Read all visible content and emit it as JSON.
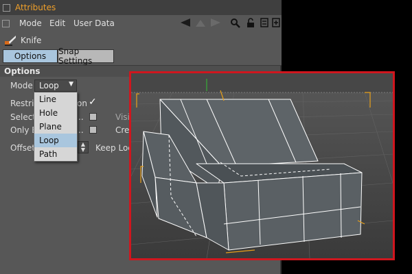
{
  "app": {
    "title": "Attributes",
    "accent_color": "#f0a02a",
    "highlight_color": "#d0161e"
  },
  "menubar": {
    "items": [
      "Mode",
      "Edit",
      "User Data"
    ],
    "icons": [
      "arrow-left-icon",
      "arrow-up-icon",
      "arrow-right-icon",
      "search-icon",
      "lock-icon",
      "settings-icon",
      "new-panel-icon"
    ]
  },
  "tool": {
    "name": "Knife",
    "icon": "knife-icon"
  },
  "tabs": {
    "options": "Options",
    "snap_settings": "Snap Settings"
  },
  "section": {
    "title": "Options"
  },
  "fields": {
    "mode_label": "Mode",
    "mode_value": "Loop",
    "restrict_label": "Restric",
    "restrict_label_tail": "on",
    "select_label": "Select",
    "select_tail": "..",
    "only_label": "Only E",
    "only_tail": "..",
    "visible_label": "Visi",
    "create_label": "Cre",
    "offset_label": "Offset",
    "keep_label": "Keep Loc"
  },
  "dropdown": {
    "options": [
      "Line",
      "Hole",
      "Plane",
      "Loop",
      "Path"
    ],
    "selected": "Loop"
  }
}
